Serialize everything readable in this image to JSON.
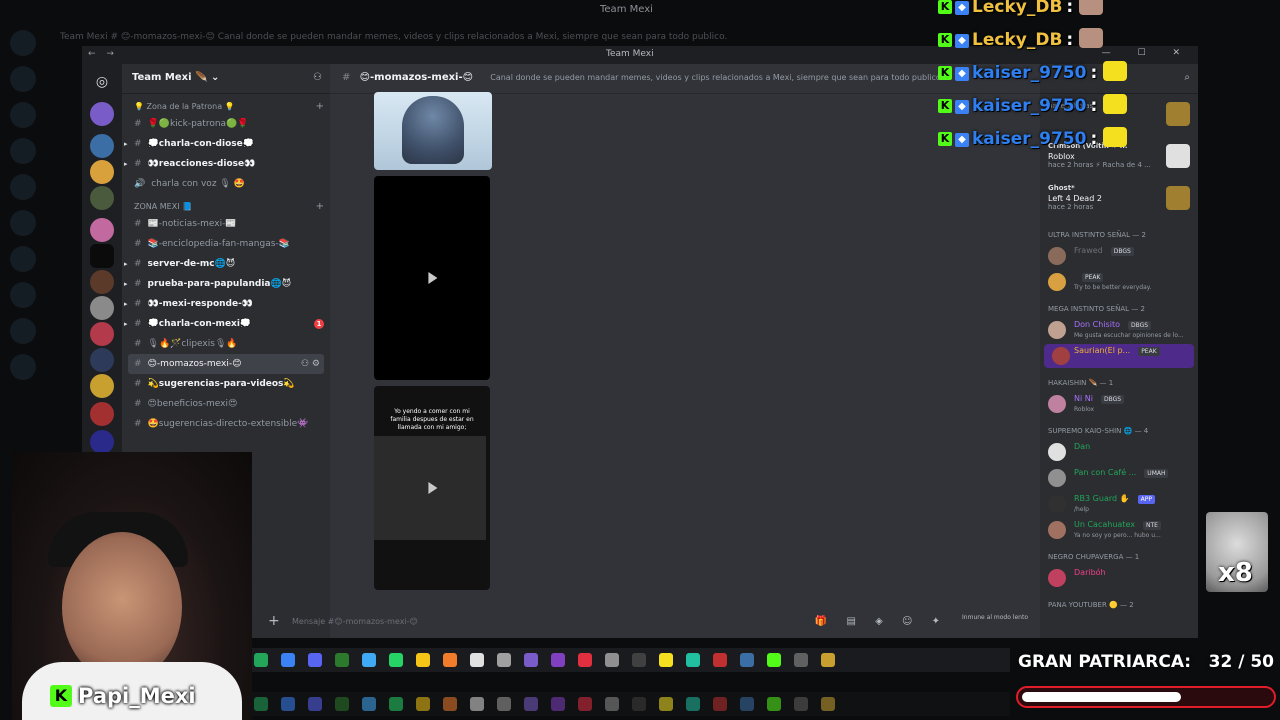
{
  "background": {
    "title": "Team Mexi",
    "channel_line": "Team Mexi        #  😊-momazos-mexi-😊      Canal donde se pueden mandar memes, videos y clips relacionados a Mexi, siempre que sean para todo publico."
  },
  "window": {
    "title": "Team Mexi",
    "nav": "← →",
    "controls": "— ☐ ✕"
  },
  "server": {
    "name": "Team Mexi 🪶",
    "chevron": "⌄"
  },
  "categories": [
    {
      "label": "💡 Zona de la Patrona 💡",
      "channels": [
        {
          "name": "🌹🟢kick-patrona🟢🌹",
          "unread": false,
          "arrow": false
        },
        {
          "name": "💭charla-con-diose💭",
          "unread": true,
          "arrow": true
        },
        {
          "name": "👀reacciones-diose👀",
          "unread": true,
          "arrow": true
        },
        {
          "name": "charla con voz 🎙 🤩",
          "unread": false,
          "arrow": false,
          "voice": true
        }
      ]
    },
    {
      "label": "ZONA MEXI 📘",
      "channels": [
        {
          "name": "📰-noticias-mexi-📰",
          "unread": false,
          "arrow": false
        },
        {
          "name": "📚-enciclopedia-fan-mangas-📚",
          "unread": false,
          "arrow": false
        },
        {
          "name": "server-de-mc🌐😈",
          "unread": true,
          "arrow": true
        },
        {
          "name": "prueba-para-papulandia🌐😈",
          "unread": true,
          "arrow": true
        },
        {
          "name": "👀-mexi-responde-👀",
          "unread": true,
          "arrow": true
        },
        {
          "name": "💭charla-con-mexi💭",
          "unread": true,
          "arrow": true,
          "badge": "1"
        },
        {
          "name": "🎙🔥🪄clipexis🎙🔥",
          "unread": false,
          "arrow": false
        },
        {
          "name": "😊-momazos-mexi-😊",
          "unread": false,
          "arrow": false,
          "selected": true
        },
        {
          "name": "💫sugerencias-para-videos💫",
          "unread": true,
          "arrow": false
        },
        {
          "name": "😍beneficios-mexi😍",
          "unread": false,
          "arrow": false
        },
        {
          "name": "🤩sugerencias-directo-extensible👾",
          "unread": false,
          "arrow": false
        }
      ]
    }
  ],
  "channel_view": {
    "name": "😊-momazos-mexi-😊",
    "topic": "Canal donde se pueden mandar memes, videos y clips relacionados a Mexi, siempre que sean para todo publico.",
    "video_caption": "Yo yendo a comer con mi familia despues de estar en llamada con mi amigo;",
    "slowmode": "Inmune al modo lento",
    "composer_placeholder": "Mensaje #😊-momazos-mexi-😊",
    "composer_icons": "🎁 ▤ ◈ ☺ ✦"
  },
  "members": {
    "activities": [
      {
        "who": "",
        "game": "",
        "meta": "hace 2 horas"
      },
      {
        "who": "Crimson (Voltin ✳ ...",
        "game": "Roblox",
        "meta": "hace 2 horas  ⚡ Racha de 4 ..."
      },
      {
        "who": "Ghost*",
        "game": "Left 4 Dead 2",
        "meta": "hace 2 horas"
      }
    ],
    "groups": [
      {
        "label": "ULTRA INSTINTO SEÑAL — 2",
        "members": [
          {
            "name": "Frawed",
            "color": "#6d6f78",
            "tag": "DBGS",
            "status": ""
          },
          {
            "name": "",
            "color": "#dbdee1",
            "tag": "PEAK",
            "status": "Try to be better everyday."
          }
        ]
      },
      {
        "label": "MEGA INSTINTO SEÑAL — 2",
        "members": [
          {
            "name": "Don Chisito",
            "color": "#a970ff",
            "tag": "DBGS",
            "status": "Me gusta escuchar opiniones de lo..."
          },
          {
            "name": "Saurian(El p...",
            "color": "#f0b232",
            "tag": "PEAK",
            "status": "",
            "highlight": true
          }
        ]
      },
      {
        "label": "HAKAISHIN 🪶 — 1",
        "members": [
          {
            "name": "Ni Ni",
            "color": "#a970ff",
            "tag": "DBGS",
            "status": "Roblox"
          }
        ]
      },
      {
        "label": "SUPREMO KAIO-SHIN 🌐 — 4",
        "members": [
          {
            "name": "Dan",
            "color": "#23a55a",
            "tag": "",
            "status": ""
          },
          {
            "name": "Pan con Café ...",
            "color": "#23a55a",
            "tag": "UMAH",
            "status": ""
          },
          {
            "name": "RB3 Guard ✋",
            "color": "#23a55a",
            "tag": "APP",
            "status": "/help"
          },
          {
            "name": "Un Cacahuatex",
            "color": "#23a55a",
            "tag": "NTE",
            "status": "Ya no soy yo pero... hubo u..."
          }
        ]
      },
      {
        "label": "NEGRO CHUPAVERGA — 1",
        "members": [
          {
            "name": "Daribóh",
            "color": "#f23f8a",
            "tag": "",
            "status": ""
          }
        ]
      },
      {
        "label": "PANA YOUTUBER 🟡 — 2",
        "members": []
      }
    ]
  },
  "overlay": {
    "chat": [
      {
        "name": "Lecky_DB",
        "color": "#f0c040",
        "sep": ":"
      },
      {
        "name": "Lecky_DB",
        "color": "#f0c040",
        "sep": ":"
      },
      {
        "name": "kaiser_9750",
        "color": "#2f7ff0",
        "sep": ":"
      },
      {
        "name": "kaiser_9750",
        "color": "#2f7ff0",
        "sep": ":"
      },
      {
        "name": "kaiser_9750",
        "color": "#2f7ff0",
        "sep": ":"
      }
    ],
    "kick_badge": "K",
    "streamer": "Papi_Mexi",
    "goal_label": "GRAN PATRIARCA:",
    "goal_count": "32 / 50",
    "goal_progress": 0.64,
    "multiplier": "x8"
  },
  "colors": {
    "kick_green": "#53fc18",
    "discord_bg": "#313338",
    "sidebar_bg": "#2b2d31",
    "goal_red": "#e11d2a"
  }
}
